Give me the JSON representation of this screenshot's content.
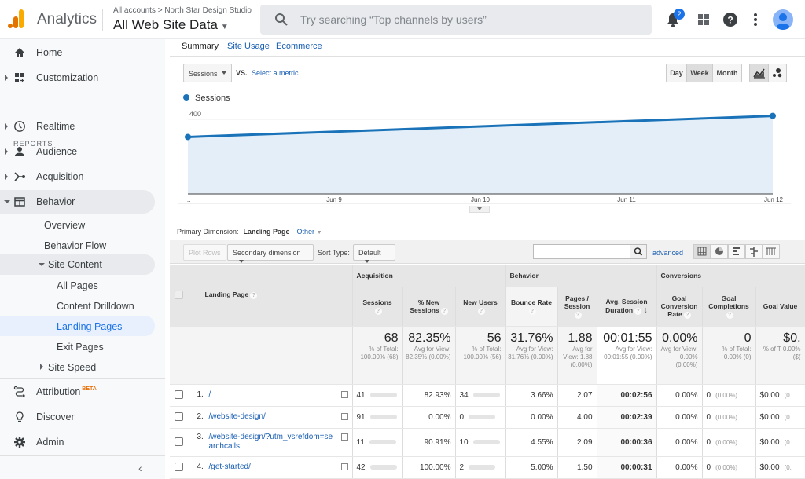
{
  "header": {
    "app_name": "Analytics",
    "breadcrumb": "All accounts > North Star Design Studio",
    "view_name": "All Web Site Data",
    "search_placeholder": "Try searching “Top channels by users”",
    "notification_count": "2",
    "brand_colors": {
      "logo_orange": "#f9ab00",
      "logo_dark": "#e37400",
      "accent": "#1a73e8"
    }
  },
  "sidebar": {
    "reports_label": "REPORTS",
    "items": [
      {
        "label": "Home",
        "icon": "home-icon"
      },
      {
        "label": "Customization",
        "icon": "dashboard-icon"
      },
      {
        "label": "Realtime",
        "icon": "clock-icon"
      },
      {
        "label": "Audience",
        "icon": "person-icon"
      },
      {
        "label": "Acquisition",
        "icon": "acquisition-icon"
      },
      {
        "label": "Behavior",
        "icon": "behavior-icon"
      },
      {
        "label": "Overview"
      },
      {
        "label": "Behavior Flow"
      },
      {
        "label": "Site Content"
      },
      {
        "label": "All Pages"
      },
      {
        "label": "Content Drilldown"
      },
      {
        "label": "Landing Pages"
      },
      {
        "label": "Exit Pages"
      },
      {
        "label": "Site Speed"
      },
      {
        "label": "Attribution",
        "badge": "BETA",
        "icon": "attribution-icon"
      },
      {
        "label": "Discover",
        "icon": "lightbulb-icon"
      },
      {
        "label": "Admin",
        "icon": "gear-icon"
      }
    ],
    "collapse_icon": "chevron-left-icon"
  },
  "explorer": {
    "tabs": [
      "Summary",
      "Site Usage",
      "Ecommerce"
    ],
    "metric_select": "Sessions",
    "vs_label": "VS.",
    "select_metric": "Select a metric",
    "granularity": [
      "Day",
      "Week",
      "Month"
    ],
    "granularity_selected": "Week"
  },
  "chart_data": {
    "type": "area",
    "title": "",
    "legend": [
      "Sessions"
    ],
    "x": [
      "…",
      "Jun 9",
      "Jun 10",
      "Jun 11",
      "Jun 12"
    ],
    "series": [
      {
        "name": "Sessions",
        "points": [
          [
            0,
            305
          ],
          [
            4,
            418
          ]
        ]
      }
    ],
    "yticks": [
      200,
      400
    ],
    "ylim": [
      0,
      450
    ],
    "xlabel": "",
    "ylabel": "",
    "grid": true,
    "legend_position": "top-left",
    "color": "#1a73b8"
  },
  "dimension": {
    "label": "Primary Dimension:",
    "current": "Landing Page",
    "other": "Other"
  },
  "toolbar": {
    "plot_rows": "Plot Rows",
    "secondary_dimension": "Secondary dimension",
    "sort_type_label": "Sort Type:",
    "sort_type_value": "Default",
    "search_value": "",
    "advanced": "advanced"
  },
  "table": {
    "group_headers": {
      "acquisition": "Acquisition",
      "behavior": "Behavior",
      "conversions": "Conversions"
    },
    "columns": {
      "landing_page": "Landing Page",
      "sessions": "Sessions",
      "pct_new": "% New Sessions",
      "new_users": "New Users",
      "bounce": "Bounce Rate",
      "pages": "Pages / Session",
      "duration": "Avg. Session Duration",
      "goal_rate": "Goal Conversion Rate",
      "goal_comp": "Goal Completions",
      "goal_value": "Goal Value"
    },
    "totals": {
      "sessions": "68",
      "sessions_sub": "% of Total: 100.00% (68)",
      "pct_new": "82.35%",
      "pct_new_sub": "Avg for View: 82.35% (0.00%)",
      "new_users": "56",
      "new_users_sub": "% of Total: 100.00% (56)",
      "bounce": "31.76%",
      "bounce_sub": "Avg for View: 31.76% (0.00%)",
      "pages": "1.88",
      "pages_sub": "Avg for View: 1.88 (0.00%)",
      "duration": "00:01:55",
      "duration_sub": "Avg for View: 00:01:55 (0.00%)",
      "goal_rate": "0.00%",
      "goal_rate_sub": "Avg for View: 0.00% (0.00%)",
      "goal_comp": "0",
      "goal_comp_sub": "% of Total: 0.00% (0)",
      "goal_value": "$0.",
      "goal_value_sub": "% of T 0.00% ($("
    },
    "rows": [
      {
        "idx": "1.",
        "page": "/",
        "sessions": "41",
        "pct_new": "82.93%",
        "new_users": "34",
        "bounce": "3.66%",
        "pages": "2.07",
        "duration": "00:02:56",
        "goal_rate": "0.00%",
        "goal_comp": "0",
        "goal_comp_pct": "(0.00%)",
        "goal_value": "$0.00",
        "goal_value_pct": "(0."
      },
      {
        "idx": "2.",
        "page": "/website-design/",
        "sessions": "91",
        "pct_new": "0.00%",
        "new_users": "0",
        "bounce": "0.00%",
        "pages": "4.00",
        "duration": "00:02:39",
        "goal_rate": "0.00%",
        "goal_comp": "0",
        "goal_comp_pct": "(0.00%)",
        "goal_value": "$0.00",
        "goal_value_pct": "(0."
      },
      {
        "idx": "3.",
        "page": "/website-design/?utm_vsrefdom=searchcalls",
        "sessions": "11",
        "pct_new": "90.91%",
        "new_users": "10",
        "bounce": "4.55%",
        "pages": "2.09",
        "duration": "00:00:36",
        "goal_rate": "0.00%",
        "goal_comp": "0",
        "goal_comp_pct": "(0.00%)",
        "goal_value": "$0.00",
        "goal_value_pct": "(0."
      },
      {
        "idx": "4.",
        "page": "/get-started/",
        "sessions": "42",
        "pct_new": "100.00%",
        "new_users": "2",
        "bounce": "5.00%",
        "pages": "1.50",
        "duration": "00:00:31",
        "goal_rate": "0.00%",
        "goal_comp": "0",
        "goal_comp_pct": "(0.00%)",
        "goal_value": "$0.00",
        "goal_value_pct": "(0."
      }
    ]
  }
}
